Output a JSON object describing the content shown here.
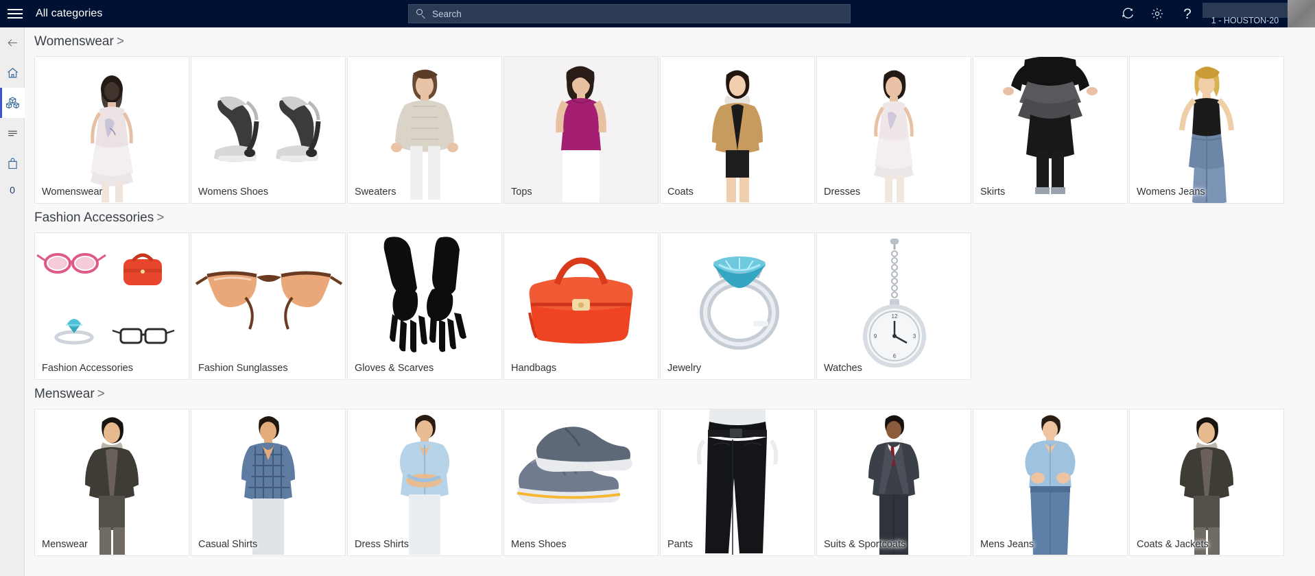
{
  "header": {
    "menu_icon": "hamburger-icon",
    "title": "All categories",
    "search": {
      "icon": "search-icon",
      "placeholder": "Search",
      "value": ""
    },
    "sync_icon": "refresh-icon",
    "settings_icon": "gear-icon",
    "help_icon": "question-mark-icon",
    "station": "1 - HOUSTON-20",
    "avatar": "user-avatar"
  },
  "sidebar": {
    "items": [
      {
        "icon": "back-arrow-icon",
        "name": "back",
        "active": false
      },
      {
        "icon": "home-icon",
        "name": "home",
        "active": false
      },
      {
        "icon": "products-boxes-icon",
        "name": "products",
        "active": true
      },
      {
        "icon": "list-lines-icon",
        "name": "transactions",
        "active": false
      },
      {
        "icon": "shopping-bag-icon",
        "name": "cart",
        "active": false
      }
    ],
    "cart_count": "0"
  },
  "sections": [
    {
      "title": "Womenswear",
      "chevron": ">",
      "tiles": [
        {
          "label": "Womenswear",
          "art": "woman-dress"
        },
        {
          "label": "Womens Shoes",
          "art": "heels"
        },
        {
          "label": "Sweaters",
          "art": "woman-sweater"
        },
        {
          "label": "Tops",
          "art": "woman-top"
        },
        {
          "label": "Coats",
          "art": "woman-coat"
        },
        {
          "label": "Dresses",
          "art": "woman-dress2"
        },
        {
          "label": "Skirts",
          "art": "woman-skirt"
        },
        {
          "label": "Womens Jeans",
          "art": "woman-jeans"
        }
      ]
    },
    {
      "title": "Fashion Accessories",
      "chevron": ">",
      "tiles": [
        {
          "label": "Fashion Accessories",
          "art": "accessories-group"
        },
        {
          "label": "Fashion Sunglasses",
          "art": "sunglasses"
        },
        {
          "label": "Gloves & Scarves",
          "art": "gloves"
        },
        {
          "label": "Handbags",
          "art": "handbag"
        },
        {
          "label": "Jewelry",
          "art": "ring"
        },
        {
          "label": "Watches",
          "art": "pocket-watch"
        }
      ]
    },
    {
      "title": "Menswear",
      "chevron": ">",
      "tiles": [
        {
          "label": "Menswear",
          "art": "man-jacket"
        },
        {
          "label": "Casual Shirts",
          "art": "man-plaid"
        },
        {
          "label": "Dress Shirts",
          "art": "man-dressshirt"
        },
        {
          "label": "Mens Shoes",
          "art": "sneakers"
        },
        {
          "label": "Pants",
          "art": "man-pants"
        },
        {
          "label": "Suits & Sportcoats",
          "art": "man-suit"
        },
        {
          "label": "Mens Jeans",
          "art": "man-jeans"
        },
        {
          "label": "Coats & Jackets",
          "art": "man-jacket2"
        }
      ]
    }
  ],
  "colors": {
    "header_bg": "#001233",
    "accent": "#3b53d4",
    "rail_bg": "#eeeeee",
    "content_bg": "#f8f8f8",
    "tile_bg": "#ffffff"
  }
}
